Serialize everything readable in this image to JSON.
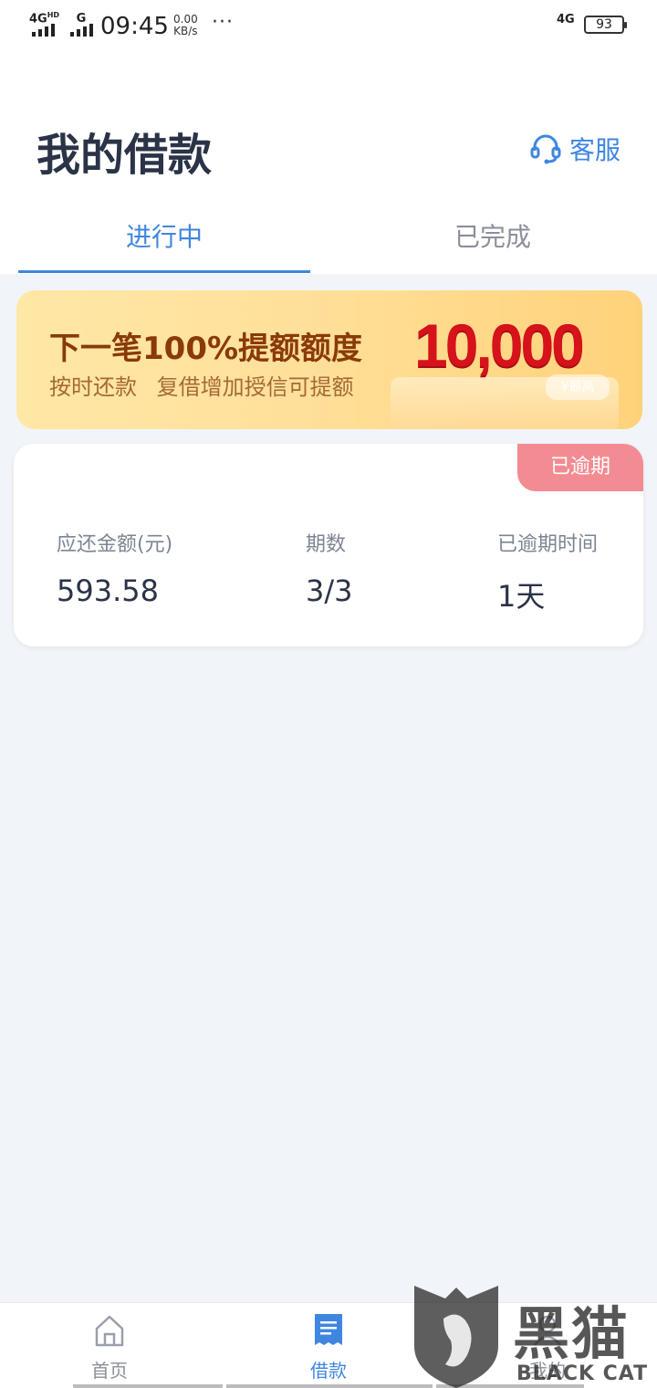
{
  "status_bar": {
    "network_left": "4G",
    "network_left_hd": "HD",
    "network_second": "G",
    "time": "09:45",
    "speed_value": "0.00",
    "speed_unit": "KB/s",
    "more": "···",
    "network_right": "4G",
    "battery": "93"
  },
  "header": {
    "title": "我的借款",
    "service_label": "客服",
    "service_icon": "headset-icon"
  },
  "tabs": {
    "active": "进行中",
    "inactive": "已完成"
  },
  "banner": {
    "title": "下一笔100%提额额度",
    "subtitle": "按时还款 复借增加授信可提额",
    "amount": "10,000",
    "tag": "¥最高"
  },
  "loan_card": {
    "badge": "已逾期",
    "badge_color": "#f28c92",
    "columns": [
      {
        "label": "应还金额(元)",
        "value": "593.58"
      },
      {
        "label": "期数",
        "value": "3/3"
      },
      {
        "label": "已逾期时间",
        "value": "1天"
      }
    ]
  },
  "bottom_nav": {
    "items": [
      {
        "label": "首页",
        "icon": "home-icon"
      },
      {
        "label": "借款",
        "icon": "bill-icon"
      },
      {
        "label": "我的",
        "icon": "user-icon"
      }
    ],
    "accent": "#3f86e0"
  },
  "watermark": {
    "title": "黑猫",
    "subtitle": "BLACK CAT",
    "icon": "black-cat-shield-icon"
  }
}
